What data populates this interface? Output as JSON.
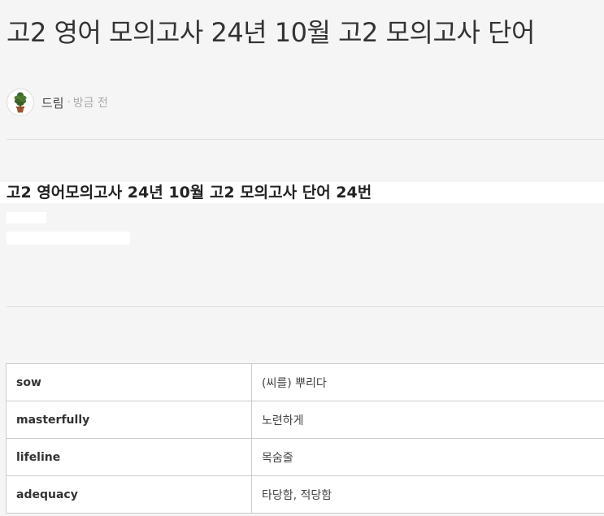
{
  "post": {
    "title": "고2 영어 모의고사 24년 10월 고2 모의고사 단어",
    "author": "드림",
    "separator": "·",
    "time": "방금 전",
    "avatar_icon": "potted-tree-icon"
  },
  "content": {
    "heading": "고2 영어모의고사 24년 10월 고2 모의고사 단어 24번"
  },
  "vocab": [
    {
      "word": "sow",
      "meaning": "(씨를) 뿌리다"
    },
    {
      "word": "masterfully",
      "meaning": "노련하게"
    },
    {
      "word": "lifeline",
      "meaning": "목숨줄"
    },
    {
      "word": "adequacy",
      "meaning": "타당함, 적당함"
    }
  ]
}
